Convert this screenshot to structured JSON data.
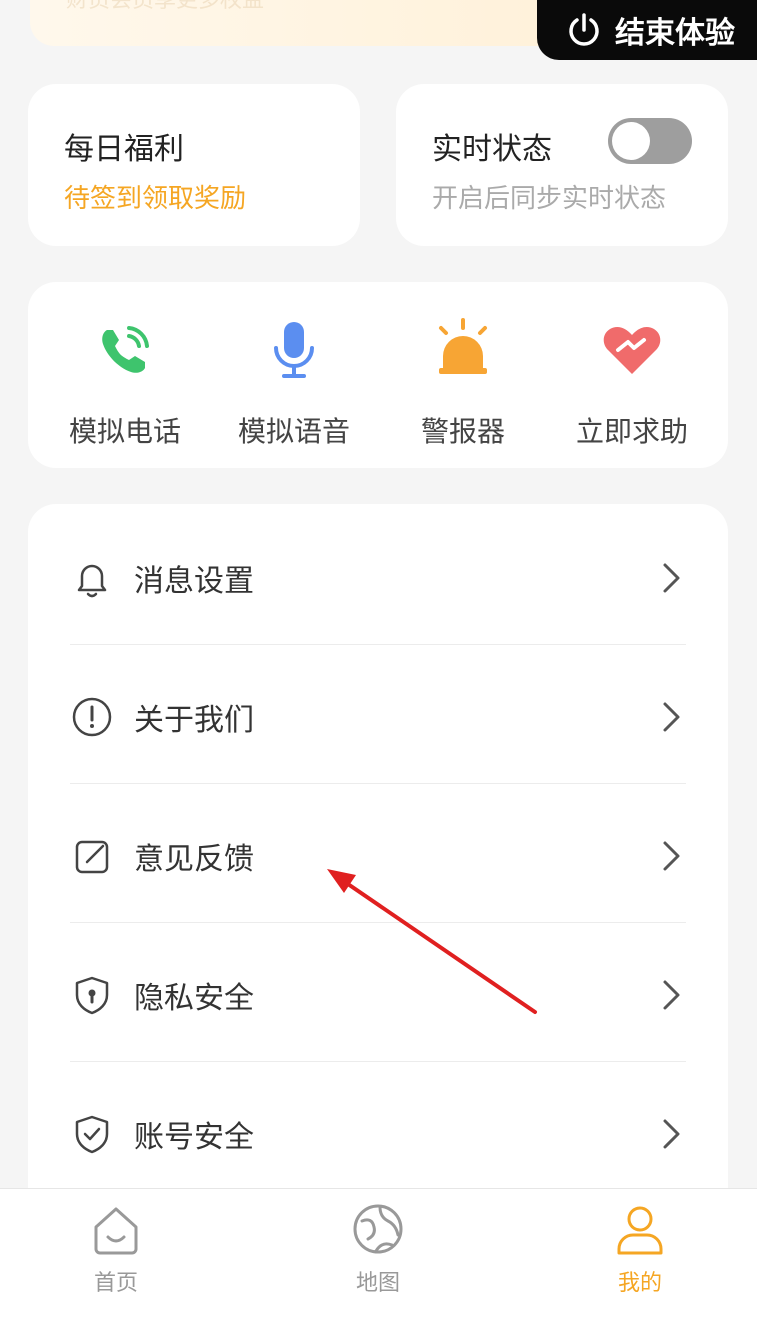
{
  "banner": {
    "faded_text": "财员会员享更多权益"
  },
  "end_experience": {
    "label": "结束体验",
    "icon": "power-icon"
  },
  "daily_welfare": {
    "title": "每日福利",
    "subtitle": "待签到领取奖励",
    "subtitle_color": "#f5a623"
  },
  "realtime_status": {
    "title": "实时状态",
    "subtitle": "开启后同步实时状态",
    "toggle_on": false
  },
  "tools": [
    {
      "label": "模拟电话",
      "icon": "phone-call-icon",
      "color": "#3ec46d"
    },
    {
      "label": "模拟语音",
      "icon": "microphone-icon",
      "color": "#5b8ef0"
    },
    {
      "label": "警报器",
      "icon": "alarm-siren-icon",
      "color": "#f7a534"
    },
    {
      "label": "立即求助",
      "icon": "heart-handshake-icon",
      "color": "#f06b6b"
    }
  ],
  "menu": [
    {
      "label": "消息设置",
      "icon": "bell-icon"
    },
    {
      "label": "关于我们",
      "icon": "info-exclamation-icon"
    },
    {
      "label": "意见反馈",
      "icon": "edit-feedback-icon"
    },
    {
      "label": "隐私安全",
      "icon": "shield-lock-icon"
    },
    {
      "label": "账号安全",
      "icon": "shield-check-icon"
    }
  ],
  "tabbar": [
    {
      "label": "首页",
      "icon": "home-icon",
      "active": false
    },
    {
      "label": "地图",
      "icon": "globe-map-icon",
      "active": false
    },
    {
      "label": "我的",
      "icon": "user-profile-icon",
      "active": true
    }
  ],
  "colors": {
    "active_tab": "#f5a623",
    "inactive_tab": "#999999",
    "annotation_arrow": "#e02020"
  }
}
